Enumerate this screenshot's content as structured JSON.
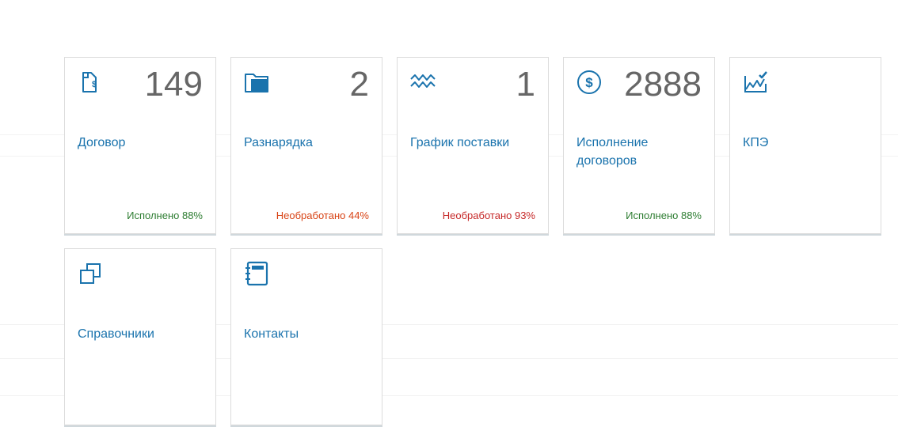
{
  "colors": {
    "accent": "#1a73ad",
    "count": "#666666",
    "status_ok": "#2e7d32",
    "status_warn": "#d84315",
    "status_bad": "#c62828"
  },
  "tiles": [
    {
      "icon": "contract-document-icon",
      "count": "149",
      "title": "Договор",
      "status": "Исполнено 88%",
      "status_color": "#2e7d32"
    },
    {
      "icon": "folder-icon",
      "count": "2",
      "title": "Разнарядка",
      "status": "Необработано 44%",
      "status_color": "#d84315"
    },
    {
      "icon": "delivery-chart-icon",
      "count": "1",
      "title": "График поставки",
      "status": "Необработано 93%",
      "status_color": "#c62828"
    },
    {
      "icon": "dollar-icon",
      "count": "2888",
      "title": "Исполнение договоров",
      "status": "Исполнено 88%",
      "status_color": "#2e7d32"
    },
    {
      "icon": "kpi-chart-icon",
      "count": "",
      "title": "КПЭ",
      "status": "",
      "status_color": ""
    },
    {
      "icon": "directories-icon",
      "count": "",
      "title": "Справочники",
      "status": "",
      "status_color": ""
    },
    {
      "icon": "address-book-icon",
      "count": "",
      "title": "Контакты",
      "status": "",
      "status_color": ""
    }
  ]
}
